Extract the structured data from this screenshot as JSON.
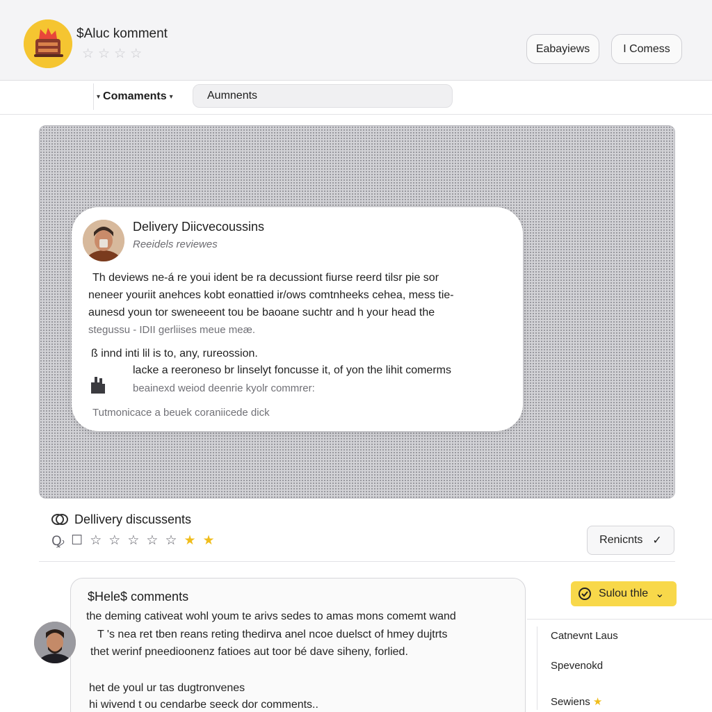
{
  "header": {
    "app_title": "$Aluc komment",
    "rating_stars": [
      "☆",
      "☆",
      "☆",
      "☆"
    ],
    "reviews_button": "Eabayiews",
    "comments_button": "I Comess"
  },
  "tabbar": {
    "dropdown_label": "Comaments",
    "search_value": "Aumnents"
  },
  "card": {
    "title": "Delivery Diicvecoussins",
    "subtitle": "Reeidels reviewes",
    "lines": [
      "Th deviews ne-á re youi ident be ra decussiont fiurse reerd tilsr pie sor",
      "neneer youriit anehces kobt eonattied ir/ows comtnheeks cehea, mess tie-",
      "aunesd youn tor sweneeent tou be baoane suchtr and h your head the",
      "stegussu - IDII gerliises meue meæ.",
      "ß innd inti lil is to, any, rureossion.",
      "lacke a reeroneso br linselyt foncusse it, of yon the lihit comerms",
      "beainexd weiod deenrie kyolr commrer:",
      "Tutmonicace a beuek coraniicede dick"
    ]
  },
  "discussion": {
    "title": "Dellivery discussents",
    "icons_row": [
      "Ꝙ",
      "☐",
      "☆",
      "☆",
      "☆",
      "☆",
      "☆",
      "★",
      "★"
    ],
    "reviews_button": "Renicnts",
    "reviews_check": "✓"
  },
  "comments": {
    "title": "$Hele$ comments",
    "lines": [
      "the deming cativeat wohl youm te arivs sedes to amas mons comemt wand",
      "T 's nea ret tben reans reting thedirva anel ncoe duelsct of hmey dujtrts",
      "thet werinf pneedioonenz fatioes aut toor bé dave siheny, forlied.",
      "het de youl ur tas dugtronvenes",
      "hi wivend t ou cendarbe seeck dor comments.."
    ]
  },
  "sidebar": {
    "solution_button": "Sulou thle",
    "items": [
      "Catnevnt Laus",
      "Spevenokd",
      "Sewiens"
    ],
    "star": "★"
  },
  "colors": {
    "accent_yellow": "#f8d84a",
    "star_yellow": "#f0bd1c",
    "header_bg": "#f4f4f6"
  }
}
